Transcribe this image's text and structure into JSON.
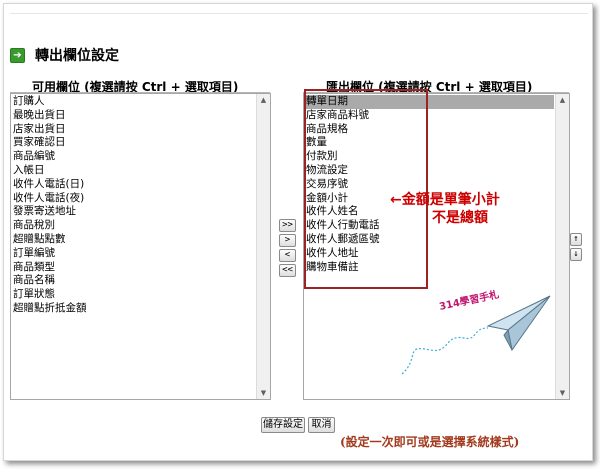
{
  "section": {
    "title": "轉出欄位設定"
  },
  "left_panel": {
    "header": "可用欄位 (複選請按 Ctrl + 選取項目)",
    "items": [
      "訂購人",
      "最晚出貨日",
      "店家出貨日",
      "買家確認日",
      "商品編號",
      "入帳日",
      "收件人電話(日)",
      "收件人電話(夜)",
      "發票寄送地址",
      "商品稅別",
      "超贈點點數",
      "訂單編號",
      "商品類型",
      "商品名稱",
      "訂單狀態",
      "超贈點折抵金額"
    ]
  },
  "right_panel": {
    "header": "匯出欄位 (複選請按 Ctrl + 選取項目)",
    "items": [
      "轉單日期",
      "店家商品料號",
      "商品規格",
      "數量",
      "付款別",
      "物流設定",
      "交易序號",
      "金額小計",
      "收件人姓名",
      "收件人行動電話",
      "收件人郵遞區號",
      "收件人地址",
      "購物車備註"
    ],
    "selected_index": 0
  },
  "move_buttons": {
    "add_all": ">>",
    "add": ">",
    "remove": "<",
    "remove_all": "<<"
  },
  "order_buttons": {
    "up": "↑",
    "down": "↓"
  },
  "actions": {
    "save": "儲存設定",
    "cancel": "取消"
  },
  "annotations": {
    "arrow_note_line1": "←金額是單筆小計",
    "arrow_note_line2": "不是總額",
    "bottom_note": "(設定一次即可或是選擇系統樣式)",
    "plane_label": "314學習手札",
    "colors": {
      "red": "#cc0000",
      "box": "#9a2323",
      "plane_line": "#3aaed8"
    }
  }
}
